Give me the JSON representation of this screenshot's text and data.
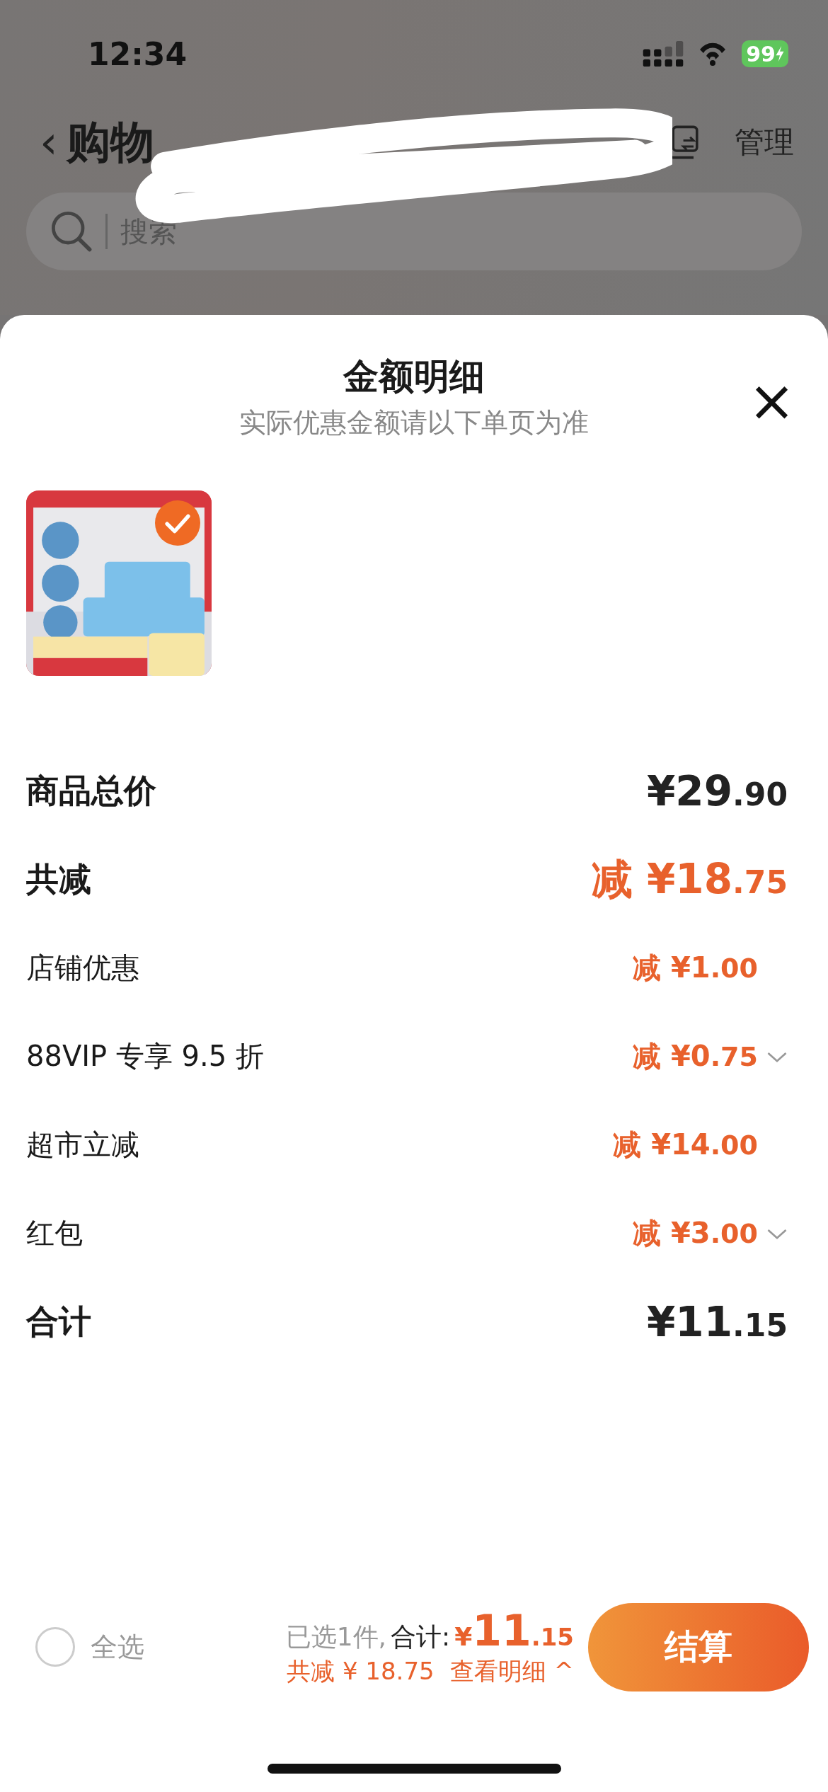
{
  "status_bar": {
    "time": "12:34",
    "battery": "99"
  },
  "header": {
    "back": "‹",
    "title": "购物",
    "manage": "管理"
  },
  "search": {
    "placeholder": "搜索"
  },
  "sheet": {
    "title": "金额明细",
    "subtitle": "实际优惠金额请以下单页为准",
    "close": "×"
  },
  "products": [
    {
      "kind": "picture",
      "selected": true
    }
  ],
  "rows": [
    {
      "kind": "major",
      "label": "商品总价",
      "prefix": "",
      "main": "¥29",
      "cents": ".90",
      "accent": false,
      "expandable": false
    },
    {
      "kind": "major",
      "label": "共减",
      "prefix": "减",
      "main": "¥18",
      "cents": ".75",
      "accent": true,
      "expandable": false
    },
    {
      "kind": "minor",
      "label": "店铺优惠",
      "prefix": "减",
      "main": "¥1",
      "cents": ".00",
      "accent": true,
      "expandable": false
    },
    {
      "kind": "minor",
      "label": "88VIP 专享 9.5 折",
      "prefix": "减",
      "main": "¥0",
      "cents": ".75",
      "accent": true,
      "expandable": true
    },
    {
      "kind": "minor",
      "label": "超市立减",
      "prefix": "减",
      "main": "¥14",
      "cents": ".00",
      "accent": true,
      "expandable": false
    },
    {
      "kind": "minor",
      "label": "红包",
      "prefix": "减",
      "main": "¥3",
      "cents": ".00",
      "accent": true,
      "expandable": true
    },
    {
      "kind": "major",
      "label": "合计",
      "prefix": "",
      "main": "¥11",
      "cents": ".15",
      "accent": false,
      "expandable": false
    }
  ],
  "footer": {
    "select_all": {
      "label": "全选",
      "checked": false
    },
    "count": "已选1件,",
    "total_label": "合计:",
    "currency": "¥",
    "total_main": "11",
    "total_cents": ".15",
    "saved": "共减 ¥ 18.75",
    "details": "查看明细",
    "details_caret": "^",
    "checkout": "结算"
  }
}
